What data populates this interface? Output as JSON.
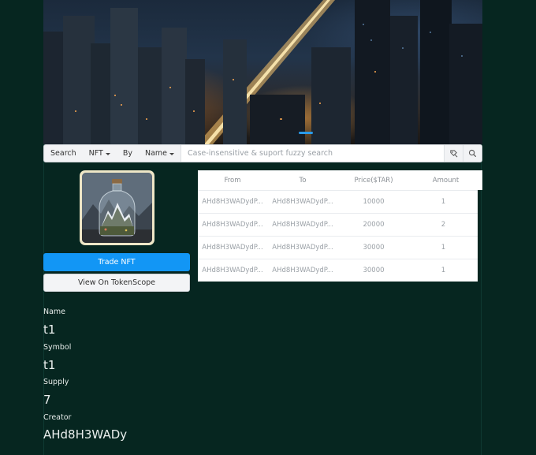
{
  "search": {
    "label": "Search",
    "type_select": "NFT",
    "by_label": "By",
    "field_select": "Name",
    "placeholder": "Case-insensitive & suport fuzzy search"
  },
  "actions": {
    "trade": "Trade NFT",
    "view_scope": "View On TokenScope"
  },
  "details": {
    "name_label": "Name",
    "name_value": "t1",
    "symbol_label": "Symbol",
    "symbol_value": "t1",
    "supply_label": "Supply",
    "supply_value": "7",
    "creator_label": "Creator",
    "creator_value": "AHd8H3WADy"
  },
  "table": {
    "columns": [
      "From",
      "To",
      "Price($TAR)",
      "Amount"
    ],
    "rows": [
      {
        "from": "AHd8H3WADydP...",
        "to": "AHd8H3WADydP...",
        "price": "10000",
        "amount": "1"
      },
      {
        "from": "AHd8H3WADydP...",
        "to": "AHd8H3WADydP...",
        "price": "20000",
        "amount": "2"
      },
      {
        "from": "AHd8H3WADydP...",
        "to": "AHd8H3WADydP...",
        "price": "30000",
        "amount": "1"
      },
      {
        "from": "AHd8H3WADydP...",
        "to": "AHd8H3WADydP...",
        "price": "30000",
        "amount": "1"
      }
    ]
  },
  "colors": {
    "background": "#062620",
    "accent": "#1296f5",
    "carousel_dot": "#2b9be9"
  }
}
